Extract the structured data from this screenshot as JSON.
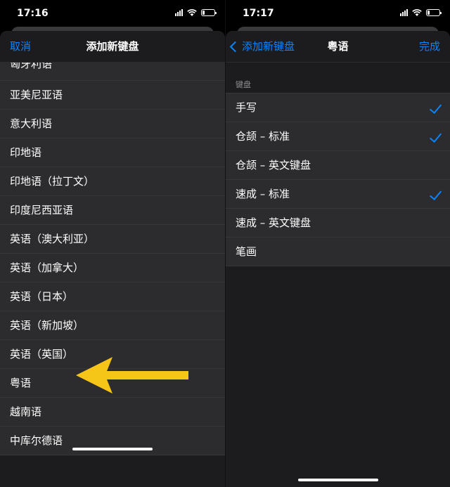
{
  "left": {
    "status": {
      "time": "17:16",
      "battery_level": 0.2
    },
    "nav": {
      "cancel": "取消",
      "title": "添加新键盘"
    },
    "languages": [
      "匈牙利语",
      "亚美尼亚语",
      "意大利语",
      "印地语",
      "印地语（拉丁文）",
      "印度尼西亚语",
      "英语（澳大利亚）",
      "英语（加拿大）",
      "英语（日本）",
      "英语（新加坡）",
      "英语（英国）",
      "粤语",
      "越南语",
      "中库尔德语"
    ]
  },
  "right": {
    "status": {
      "time": "17:17",
      "battery_level": 0.2
    },
    "nav": {
      "back": "添加新键盘",
      "title": "粤语",
      "done": "完成"
    },
    "section_header": "键盘",
    "options": [
      {
        "label": "手写",
        "checked": true
      },
      {
        "label": "仓颉 – 标准",
        "checked": true
      },
      {
        "label": "仓颉 – 英文键盘",
        "checked": false
      },
      {
        "label": "速成 – 标准",
        "checked": true
      },
      {
        "label": "速成 – 英文键盘",
        "checked": false
      },
      {
        "label": "笔画",
        "checked": false
      }
    ]
  },
  "colors": {
    "accent": "#0a84ff",
    "arrow": "#f5c518"
  },
  "icons": [
    "signal-icon",
    "wifi-icon",
    "battery-icon",
    "chevron-left-icon",
    "checkmark-icon",
    "arrow-annotation"
  ]
}
